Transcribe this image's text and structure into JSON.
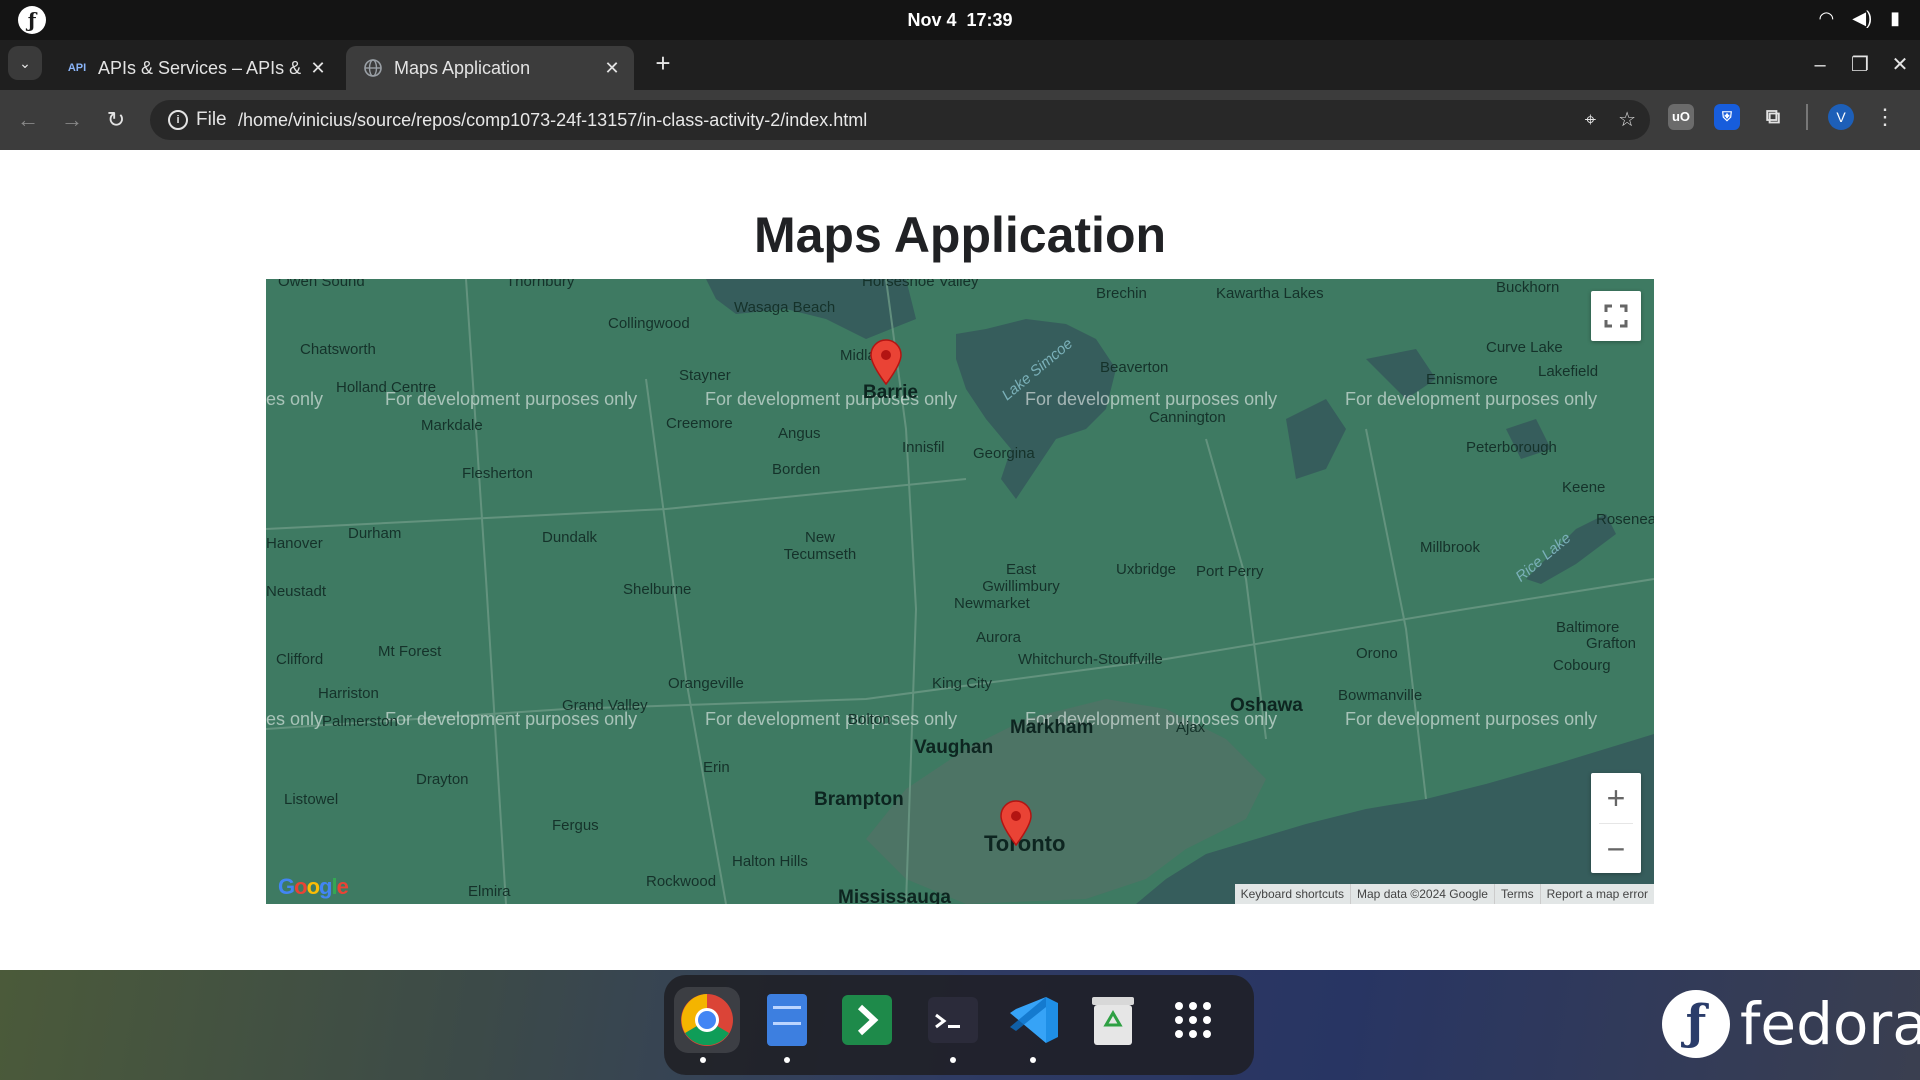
{
  "system": {
    "date": "Nov 4",
    "time": "17:39"
  },
  "browser": {
    "tabs": [
      {
        "favicon": "API",
        "title": "APIs & Services – APIs & S"
      },
      {
        "favicon": "globe-icon",
        "title": "Maps Application"
      }
    ],
    "omnibox": {
      "chip": "File",
      "url": "/home/vinicius/source/repos/comp1073-24f-13157/in-class-activity-2/index.html"
    },
    "profile_initial": "V"
  },
  "page": {
    "title": "Maps Application"
  },
  "map": {
    "watermark": "For development purposes only",
    "watermark_cut_left": "es only",
    "markers": [
      "Barrie",
      "Toronto"
    ],
    "labels": {
      "places": [
        "Owen Sound",
        "Thornbury",
        "Horseshoe Valley",
        "Brechin",
        "Kawartha Lakes",
        "Buckhorn",
        "Wasaga Beach",
        "Collingwood",
        "Chatsworth",
        "Stayner",
        "Midland",
        "Barrie",
        "Beaverton",
        "Curve Lake",
        "Lakefield",
        "Holland Centre",
        "Ennismore",
        "Markdale",
        "Creemore",
        "Angus",
        "Innisfil",
        "Georgina",
        "Cannington",
        "Peterborough",
        "Flesherton",
        "Borden",
        "Keene",
        "Durham",
        "Dundalk",
        "New Tecumseth",
        "Millbrook",
        "Hanover",
        "East Gwillimbury",
        "Uxbridge",
        "Port Perry",
        "Rice Lake",
        "Neustadt",
        "Shelburne",
        "Newmarket",
        "Baltimore",
        "Aurora",
        "Orono",
        "Clifford",
        "Mt Forest",
        "Whitchurch-Stouffville",
        "Cobourg",
        "Harriston",
        "Orangeville",
        "King City",
        "Grand Valley",
        "Bolton",
        "Markham",
        "Oshawa",
        "Bowmanville",
        "Palmerston",
        "Vaughan",
        "Ajax",
        "Erin",
        "Listowel",
        "Drayton",
        "Brampton",
        "Fergus",
        "Toronto",
        "Halton Hills",
        "Rockwood",
        "Elmira",
        "Mississauga",
        "Rosenea",
        "Grafton"
      ],
      "lake_simcoe": "Lake Simcoe",
      "rice_lake": "Rice Lake"
    },
    "attribution": [
      "Keyboard shortcuts",
      "Map data ©2024 Google",
      "Terms",
      "Report a map error"
    ],
    "logo_text": "Google"
  },
  "dock": {
    "apps": [
      "Google Chrome",
      "Files",
      "Utility",
      "Terminal",
      "Visual Studio Code",
      "Trash"
    ],
    "app_grid_icon": "grid-icon"
  },
  "desktop": {
    "brand": "fedora"
  }
}
